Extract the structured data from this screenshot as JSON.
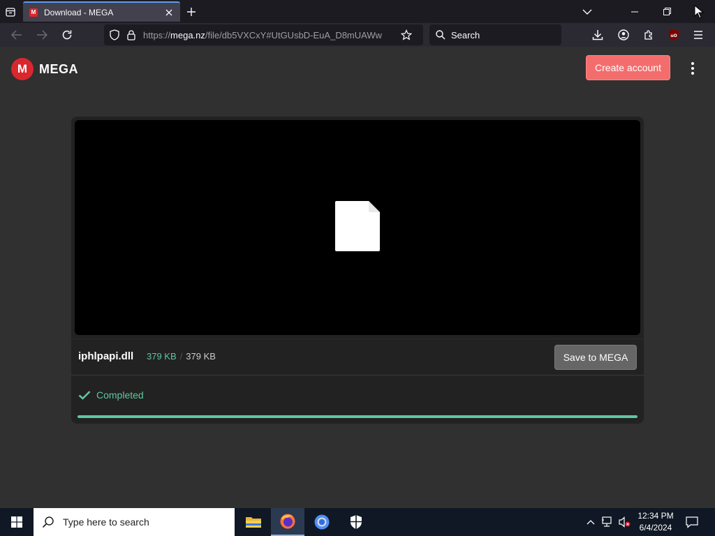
{
  "browser": {
    "tab": {
      "title": "Download - MEGA",
      "favicon_letter": "M"
    },
    "url": {
      "prefix": "https://",
      "host": "mega.nz",
      "path": "/file/db5VXCxY#UtGUsbD-EuA_D8mUAWw"
    },
    "search_placeholder": "Search",
    "extension_badge": "uO"
  },
  "mega": {
    "logo_letter": "M",
    "brand": "MEGA",
    "create_account": "Create account"
  },
  "file": {
    "name": "iphlpapi.dll",
    "downloaded": "379 KB",
    "separator": "/",
    "total": "379 KB",
    "save_button": "Save to MEGA",
    "status": "Completed",
    "progress_percent": 100
  },
  "taskbar": {
    "search_placeholder": "Type here to search",
    "time": "12:34 PM",
    "date": "6/4/2024"
  },
  "colors": {
    "accent_green": "#5ec7a0",
    "create_button": "#f46d6d",
    "mega_red": "#d9272e"
  }
}
